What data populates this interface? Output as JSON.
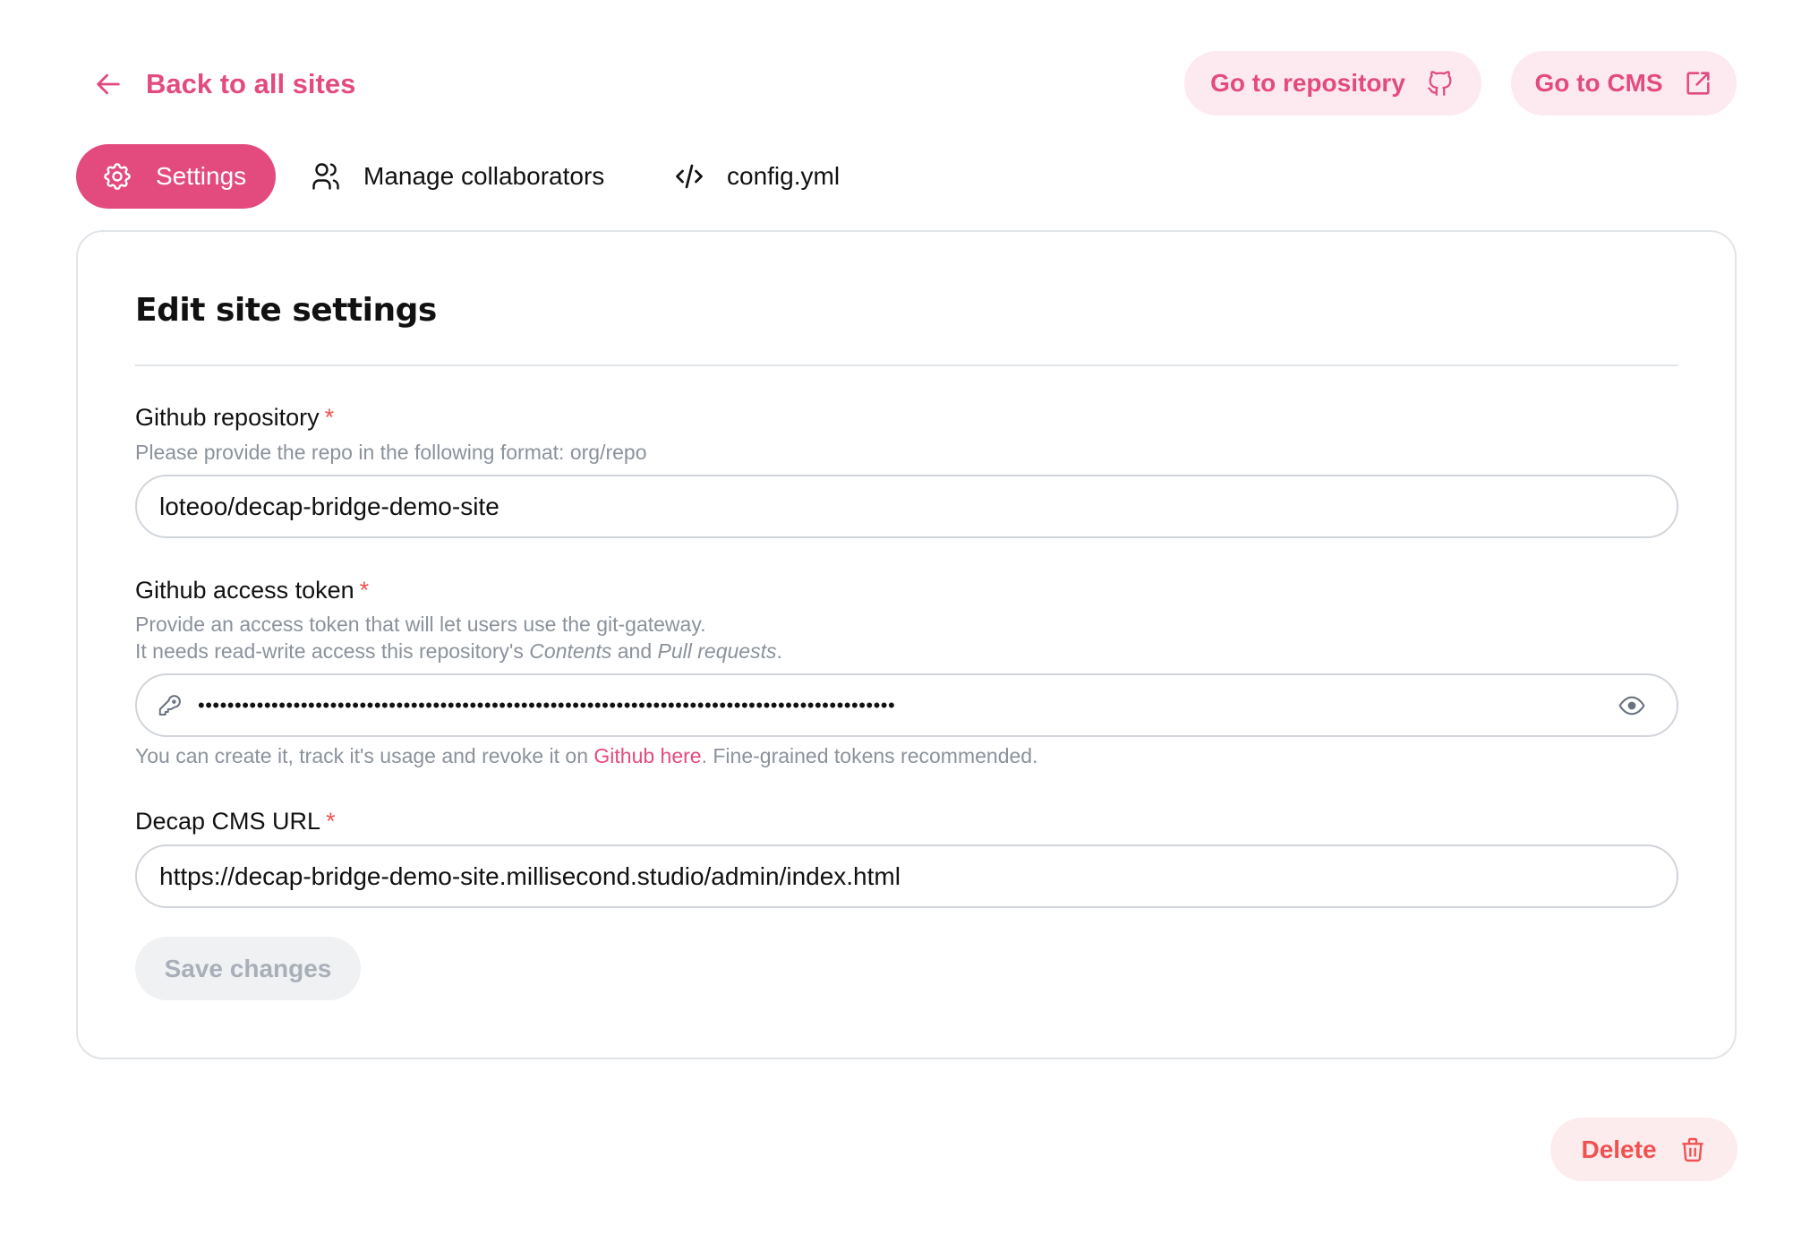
{
  "nav": {
    "back_label": "Back to all sites",
    "repo_button_label": "Go to repository",
    "cms_button_label": "Go to CMS"
  },
  "tabs": [
    {
      "label": "Settings",
      "icon": "gear-icon",
      "active": true
    },
    {
      "label": "Manage collaborators",
      "icon": "users-icon",
      "active": false
    },
    {
      "label": "config.yml",
      "icon": "code-icon",
      "active": false
    }
  ],
  "form": {
    "title": "Edit site settings",
    "required_marker": "*",
    "repository": {
      "label": "Github repository",
      "help": "Please provide the repo in the following format: org/repo",
      "value": "loteoo/decap-bridge-demo-site"
    },
    "token": {
      "label": "Github access token",
      "help_line1": "Provide an access token that will let users use the git-gateway.",
      "help_line2_prefix": "It needs read-write access this repository's ",
      "help_line2_em1": "Contents",
      "help_line2_mid": " and ",
      "help_line2_em2": "Pull requests",
      "help_line2_suffix": ".",
      "value": "ghp_xxxxxxxxxxxxxxxxxxxxxxxxxxxxxxxxxxxxxxxxxxxxxxxxxxxxxxxxxxxxxxxxxxxxxxxxxxxxxxxxxxxxxxxxxxx",
      "note_prefix": "You can create it, track it's usage and revoke it on ",
      "note_link": "Github here",
      "note_suffix": ". Fine-grained tokens recommended."
    },
    "cms_url": {
      "label": "Decap CMS URL",
      "value": "https://decap-bridge-demo-site.millisecond.studio/admin/index.html"
    },
    "save_label": "Save changes",
    "delete_label": "Delete"
  },
  "colors": {
    "accent": "#e34b7f",
    "accent_soft": "#fdeaf0",
    "danger": "#f05252",
    "danger_soft": "#fdeced",
    "border": "#d1d5db",
    "muted_text": "#8b929b"
  }
}
